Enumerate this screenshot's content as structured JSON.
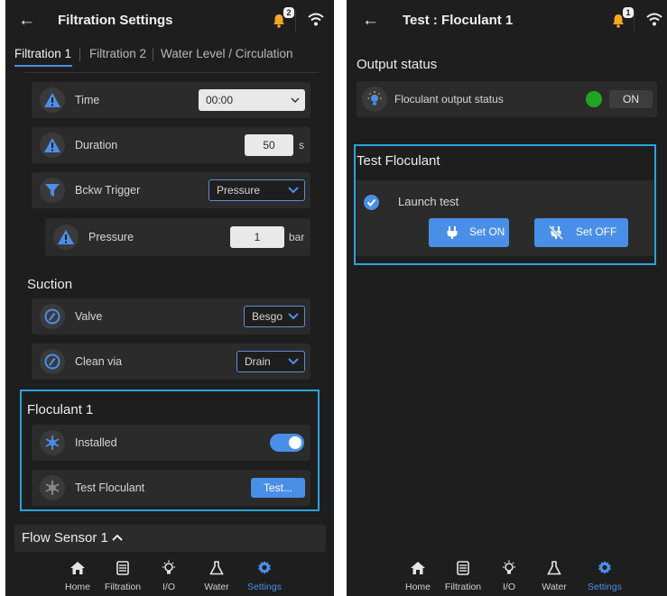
{
  "left": {
    "header": {
      "title": "Filtration Settings",
      "notif_count": "2"
    },
    "tabs": [
      {
        "label": "Filtration 1",
        "active": true
      },
      {
        "label": "Filtration 2",
        "active": false
      },
      {
        "label": "Water Level / Circulation",
        "active": false
      }
    ],
    "rows": {
      "time": {
        "label": "Time",
        "value": "00:00"
      },
      "duration": {
        "label": "Duration",
        "value": "50",
        "unit": "s"
      },
      "bckw": {
        "label": "Bckw Trigger",
        "value": "Pressure"
      },
      "pressure": {
        "label": "Pressure",
        "value": "1",
        "unit": "bar"
      }
    },
    "suction": {
      "title": "Suction",
      "valve": {
        "label": "Valve",
        "value": "Besgo"
      },
      "clean": {
        "label": "Clean via",
        "value": "Drain"
      }
    },
    "floculant": {
      "title": "Floculant 1",
      "installed": {
        "label": "Installed",
        "on": true
      },
      "test": {
        "label": "Test Floculant",
        "button": "Test..."
      }
    },
    "flow_sensor": {
      "title": "Flow Sensor 1"
    }
  },
  "right": {
    "header": {
      "title": "Test : Floculant 1",
      "notif_count": "1"
    },
    "output": {
      "title": "Output status",
      "row_label": "Floculant output status",
      "status": "ON",
      "status_color": "#1fa51f"
    },
    "test": {
      "title": "Test Floculant",
      "launch": "Launch test",
      "set_on": "Set ON",
      "set_off": "Set OFF"
    }
  },
  "nav": [
    {
      "label": "Home",
      "icon": "home-icon"
    },
    {
      "label": "Filtration",
      "icon": "filtration-icon"
    },
    {
      "label": "I/O",
      "icon": "bulb-icon"
    },
    {
      "label": "Water",
      "icon": "flask-icon"
    },
    {
      "label": "Settings",
      "icon": "gear-icon",
      "active": true
    }
  ],
  "colors": {
    "accent": "#4a8fe7",
    "highlight": "#2aa3dd",
    "warning": "#f5a623",
    "bg": "#1e1e1e",
    "row": "#2b2b2b"
  }
}
